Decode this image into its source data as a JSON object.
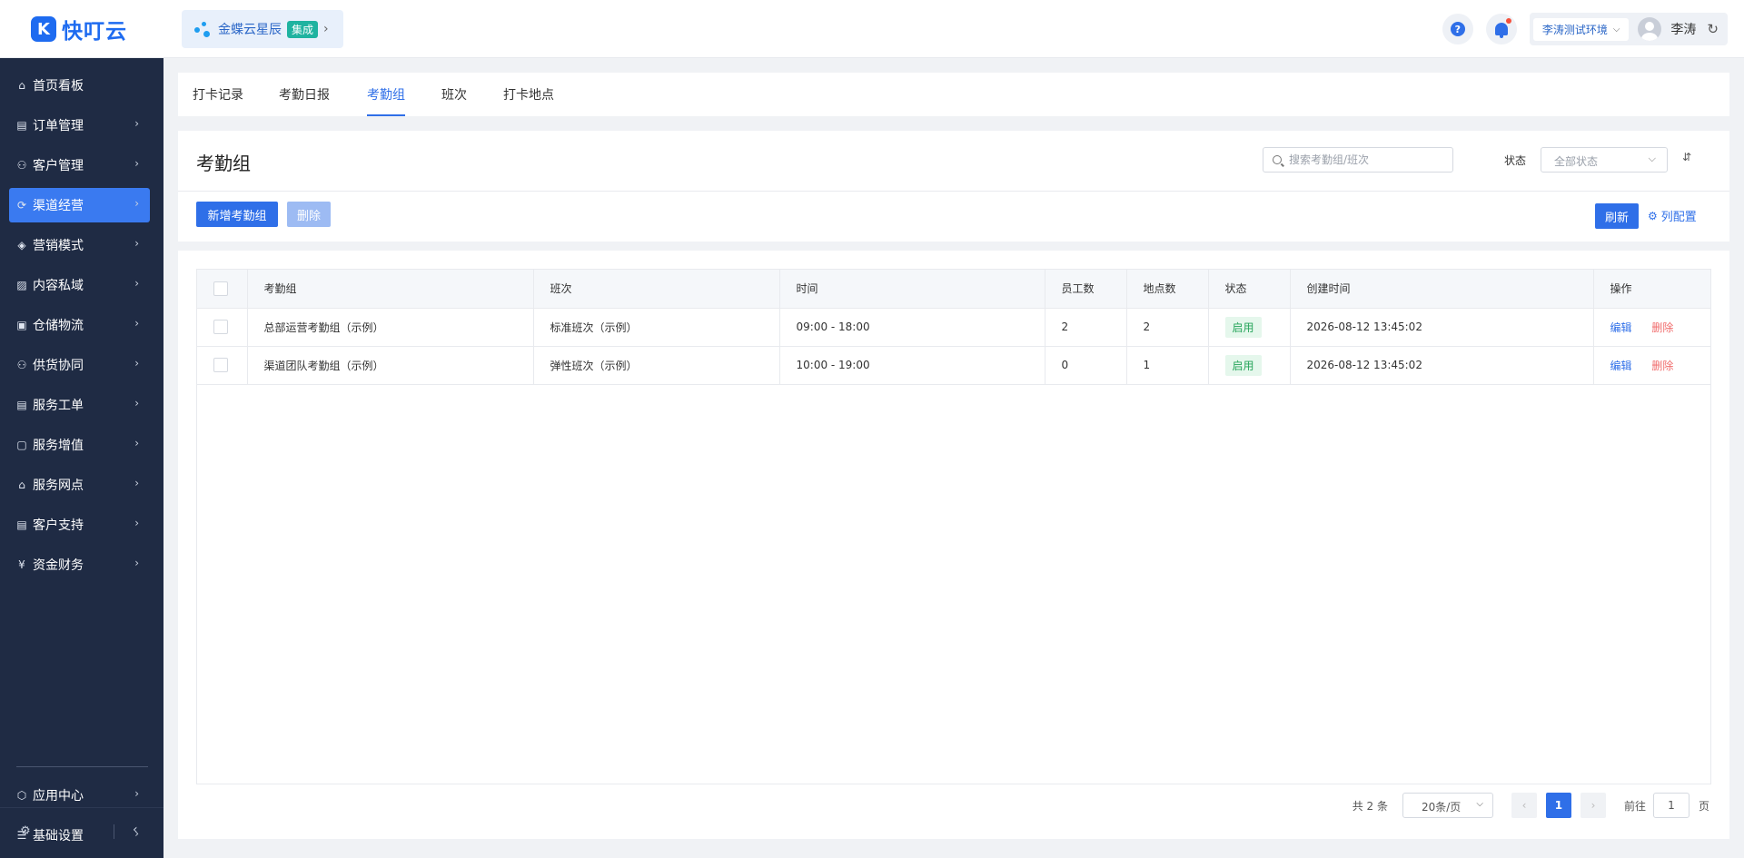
{
  "brand": {
    "logo_glyph": "K",
    "name": "快叮云"
  },
  "integration": {
    "name": "金蝶云星辰",
    "badge": "集成",
    "arrow": "›"
  },
  "header": {
    "help_glyph": "?",
    "env": "李涛测试环境",
    "user": "李涛",
    "env_chevron": "⌵",
    "refresh_glyph": "↻"
  },
  "sidebar": {
    "items": [
      {
        "label": "首页看板",
        "icon": "home-icon",
        "glyph": "⌂",
        "chev": ""
      },
      {
        "label": "订单管理",
        "icon": "clipboard-icon",
        "glyph": "▤",
        "chev": "›"
      },
      {
        "label": "客户管理",
        "icon": "user-icon",
        "glyph": "⚇",
        "chev": "›"
      },
      {
        "label": "渠道经营",
        "icon": "channel-icon",
        "glyph": "⟳",
        "chev": "›"
      },
      {
        "label": "营销模式",
        "icon": "tag-icon",
        "glyph": "◈",
        "chev": "›"
      },
      {
        "label": "内容私域",
        "icon": "image-icon",
        "glyph": "▨",
        "chev": "›"
      },
      {
        "label": "仓储物流",
        "icon": "warehouse-icon",
        "glyph": "▣",
        "chev": "›"
      },
      {
        "label": "供货协同",
        "icon": "supply-icon",
        "glyph": "⚇",
        "chev": "›"
      },
      {
        "label": "服务工单",
        "icon": "ticket-icon",
        "glyph": "▤",
        "chev": "›"
      },
      {
        "label": "服务增值",
        "icon": "bag-icon",
        "glyph": "▢",
        "chev": "›"
      },
      {
        "label": "服务网点",
        "icon": "store-icon",
        "glyph": "⌂",
        "chev": "›"
      },
      {
        "label": "客户支持",
        "icon": "support-icon",
        "glyph": "▤",
        "chev": "›"
      },
      {
        "label": "资金财务",
        "icon": "yen-icon",
        "glyph": "¥",
        "chev": "›"
      }
    ],
    "bottom_items": [
      {
        "label": "应用中心",
        "icon": "cube-icon",
        "glyph": "⬡",
        "chev": "›"
      },
      {
        "label": "基础设置",
        "icon": "settings-list-icon",
        "glyph": "☰",
        "chev": "›"
      }
    ],
    "footer": {
      "gear_glyph": "⚙",
      "collapse_glyph": "‹"
    }
  },
  "tabs": [
    "打卡记录",
    "考勤日报",
    "考勤组",
    "班次",
    "打卡地点"
  ],
  "page": {
    "title": "考勤组",
    "search_placeholder": "搜索考勤组/班次",
    "status_label": "状态",
    "status_value": "全部状态",
    "status_chevron": "⌵",
    "sort_glyph": "⇵",
    "add_button": "新增考勤组",
    "delete_button": "删除",
    "refresh_button": "刷新",
    "column_config": "列配置",
    "column_config_glyph": "⚙"
  },
  "table": {
    "columns": [
      "考勤组",
      "班次",
      "时间",
      "员工数",
      "地点数",
      "状态",
      "创建时间",
      "操作"
    ],
    "rows": [
      {
        "group": "总部运营考勤组（示例）",
        "shift": "标准班次（示例）",
        "time": "09:00 - 18:00",
        "employees": "2",
        "locations": "2",
        "status": "启用",
        "created": "2026-08-12 13:45:02",
        "edit": "编辑",
        "delete": "删除"
      },
      {
        "group": "渠道团队考勤组（示例）",
        "shift": "弹性班次（示例）",
        "time": "10:00 - 19:00",
        "employees": "0",
        "locations": "1",
        "status": "启用",
        "created": "2026-08-12 13:45:02",
        "edit": "编辑",
        "delete": "删除"
      }
    ]
  },
  "pager": {
    "total": "共 2 条",
    "page_size": "20条/页",
    "page_size_chevron": "⌵",
    "prev": "‹",
    "current": "1",
    "next": "›",
    "goto_label": "前往",
    "goto_value": "1",
    "goto_unit": "页"
  },
  "colors": {
    "accent": "#2f6fe8",
    "sidebar_bg": "#1f2b44",
    "sidebar_active": "#3a7af0",
    "success": "#27a55b",
    "danger": "#f06b6b"
  }
}
